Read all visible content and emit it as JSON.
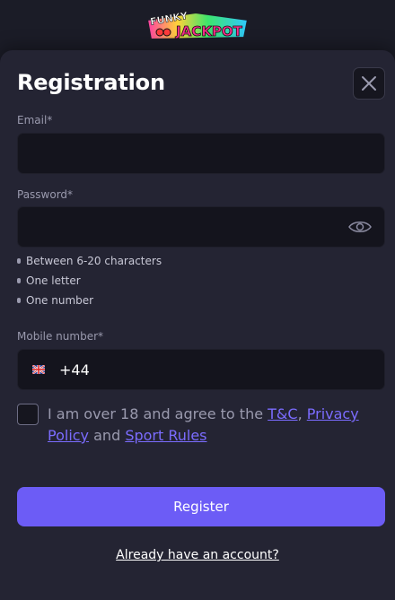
{
  "brand": {
    "logo_line1": "FUNKY",
    "logo_line2": "JACKPOT"
  },
  "form": {
    "title": "Registration",
    "email": {
      "label": "Email*",
      "value": "",
      "placeholder": ""
    },
    "password": {
      "label": "Password*",
      "value": "",
      "placeholder": "",
      "rules": [
        "Between 6-20 characters",
        "One letter",
        "One number"
      ]
    },
    "mobile": {
      "label": "Mobile number*",
      "country_code": "+44",
      "value": "",
      "flag_icon": "uk-flag-icon"
    },
    "consent": {
      "text_before": "I am over 18 and agree to the ",
      "tc_link": "T&C",
      "separator": ",",
      "privacy_link": "Privacy Policy",
      "and_text": " and ",
      "sport_rules_link": "Sport Rules",
      "checked": false
    },
    "register_label": "Register",
    "login_link": "Already have an account?"
  },
  "colors": {
    "accent": "#6c5cf6",
    "link": "#7b6cff",
    "panel": "#242433",
    "field": "#14141d"
  },
  "icons": {
    "close": "close-icon",
    "eye": "eye-icon"
  }
}
